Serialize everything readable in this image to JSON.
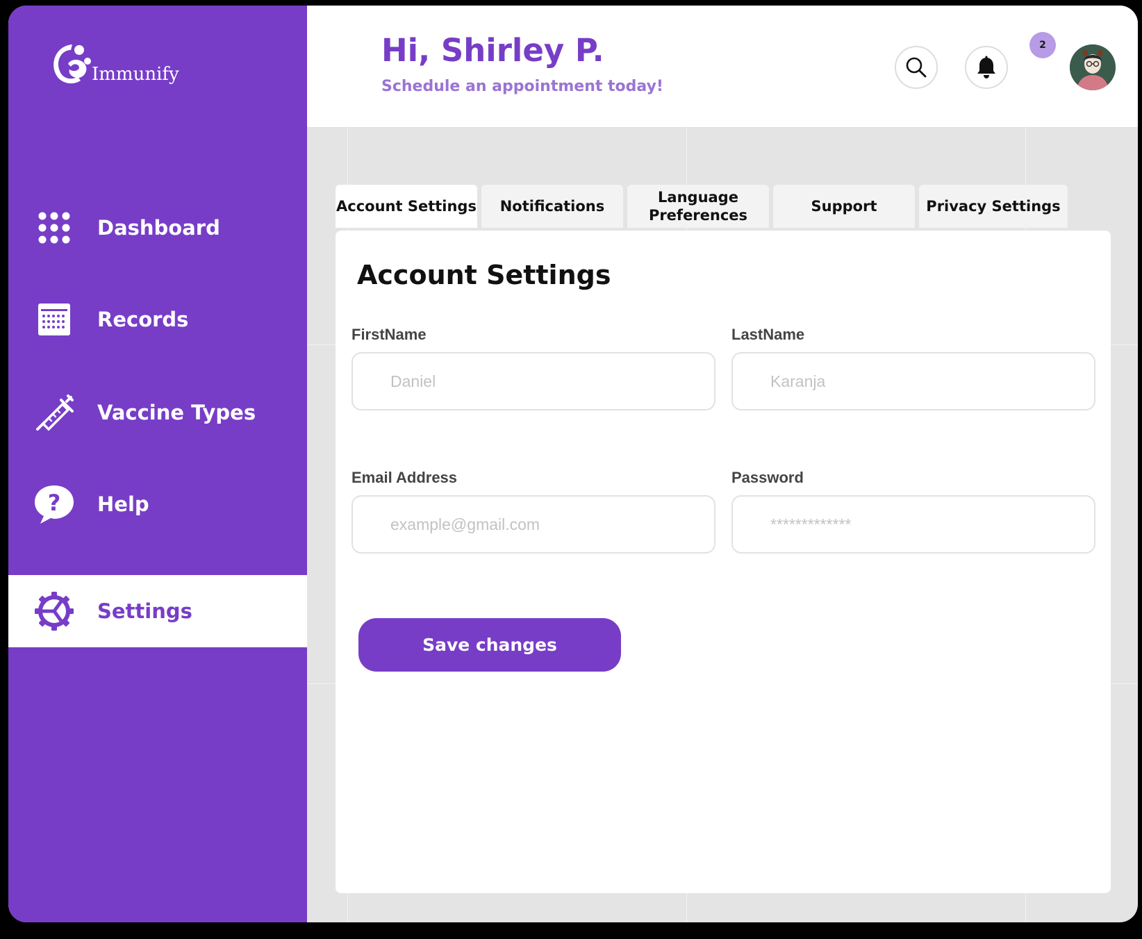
{
  "brand": {
    "name": "Immunify"
  },
  "header": {
    "greeting": "Hi, Shirley P.",
    "subtitle": "Schedule an appointment today!",
    "notification_count": "2"
  },
  "sidebar": {
    "items": [
      {
        "label": "Dashboard",
        "icon": "dots-grid-icon"
      },
      {
        "label": "Records",
        "icon": "calendar-icon"
      },
      {
        "label": "Vaccine Types",
        "icon": "syringe-icon"
      },
      {
        "label": "Help",
        "icon": "help-bubble-icon"
      },
      {
        "label": "Settings",
        "icon": "gear-icon",
        "active": true
      }
    ]
  },
  "tabs": [
    {
      "label": "Account Settings",
      "active": true
    },
    {
      "label": "Notifications"
    },
    {
      "label": "Language Preferences"
    },
    {
      "label": "Support"
    },
    {
      "label": "Privacy Settings"
    }
  ],
  "form": {
    "title": "Account Settings",
    "first_name": {
      "label": "FirstName",
      "placeholder": "Daniel"
    },
    "last_name": {
      "label": "LastName",
      "placeholder": "Karanja"
    },
    "email": {
      "label": "Email Address",
      "placeholder": "example@gmail.com"
    },
    "password": {
      "label": "Password",
      "placeholder": "*************"
    },
    "save_label": "Save changes"
  },
  "colors": {
    "primary": "#773dc7",
    "subtitle": "#9a74d4",
    "badge": "#b79be6",
    "background": "#e4e4e4"
  }
}
